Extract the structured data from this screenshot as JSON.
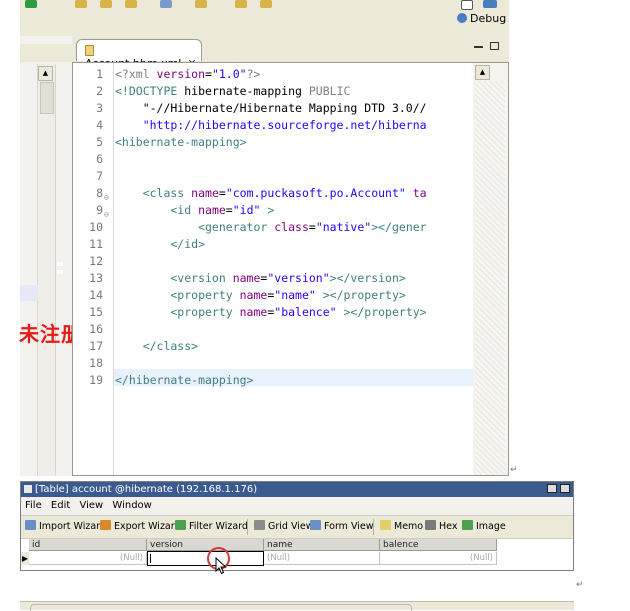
{
  "toolbar": {
    "debug_label": "Debug"
  },
  "editor": {
    "tab_label": "Account.hbm.xml",
    "lines": [
      {
        "n": "1",
        "fold": "",
        "segments": [
          {
            "c": "c-pi",
            "t": "<?xml "
          },
          {
            "c": "c-attr",
            "t": "version"
          },
          {
            "c": "c-plain",
            "t": "="
          },
          {
            "c": "c-str",
            "t": "\"1.0\""
          },
          {
            "c": "c-pi",
            "t": "?>"
          }
        ]
      },
      {
        "n": "2",
        "fold": "",
        "segments": [
          {
            "c": "c-tag",
            "t": "<!DOCTYPE "
          },
          {
            "c": "c-plain",
            "t": "hibernate-mapping "
          },
          {
            "c": "c-gray",
            "t": "PUBLIC"
          }
        ]
      },
      {
        "n": "3",
        "fold": "",
        "segments": [
          {
            "c": "c-plain",
            "t": "    \"-//Hibernate/Hibernate Mapping DTD 3.0//"
          }
        ]
      },
      {
        "n": "4",
        "fold": "",
        "segments": [
          {
            "c": "c-str",
            "t": "    \"http://hibernate.sourceforge.net/hiberna"
          }
        ]
      },
      {
        "n": "5",
        "fold": "",
        "segments": [
          {
            "c": "c-tag",
            "t": "<hibernate-mapping>"
          }
        ]
      },
      {
        "n": "6",
        "fold": "",
        "segments": []
      },
      {
        "n": "7",
        "fold": "",
        "segments": []
      },
      {
        "n": "8",
        "fold": "⊖",
        "segments": [
          {
            "c": "c-tag",
            "t": "    <class "
          },
          {
            "c": "c-attr",
            "t": "name"
          },
          {
            "c": "c-plain",
            "t": "="
          },
          {
            "c": "c-str",
            "t": "\"com.puckasoft.po.Account\""
          },
          {
            "c": "c-attr",
            "t": " ta"
          }
        ]
      },
      {
        "n": "9",
        "fold": "⊖",
        "segments": [
          {
            "c": "c-tag",
            "t": "        <id "
          },
          {
            "c": "c-attr",
            "t": "name"
          },
          {
            "c": "c-plain",
            "t": "="
          },
          {
            "c": "c-str",
            "t": "\"id\""
          },
          {
            "c": "c-tag",
            "t": " >"
          }
        ]
      },
      {
        "n": "10",
        "fold": "",
        "segments": [
          {
            "c": "c-tag",
            "t": "            <generator "
          },
          {
            "c": "c-attr",
            "t": "class"
          },
          {
            "c": "c-plain",
            "t": "="
          },
          {
            "c": "c-str",
            "t": "\"native\""
          },
          {
            "c": "c-tag",
            "t": "></gener"
          }
        ]
      },
      {
        "n": "11",
        "fold": "",
        "segments": [
          {
            "c": "c-tag",
            "t": "        </id>"
          }
        ]
      },
      {
        "n": "12",
        "fold": "",
        "segments": []
      },
      {
        "n": "13",
        "fold": "",
        "segments": [
          {
            "c": "c-tag",
            "t": "        <version "
          },
          {
            "c": "c-attr",
            "t": "name"
          },
          {
            "c": "c-plain",
            "t": "="
          },
          {
            "c": "c-str",
            "t": "\"version\""
          },
          {
            "c": "c-tag",
            "t": "></version>"
          }
        ]
      },
      {
        "n": "14",
        "fold": "",
        "segments": [
          {
            "c": "c-tag",
            "t": "        <property "
          },
          {
            "c": "c-attr",
            "t": "name"
          },
          {
            "c": "c-plain",
            "t": "="
          },
          {
            "c": "c-str",
            "t": "\"name\""
          },
          {
            "c": "c-tag",
            "t": " ></property>"
          }
        ]
      },
      {
        "n": "15",
        "fold": "",
        "segments": [
          {
            "c": "c-tag",
            "t": "        <property "
          },
          {
            "c": "c-attr",
            "t": "name"
          },
          {
            "c": "c-plain",
            "t": "="
          },
          {
            "c": "c-str",
            "t": "\"balence\""
          },
          {
            "c": "c-tag",
            "t": " ></property>"
          }
        ]
      },
      {
        "n": "16",
        "fold": "",
        "segments": []
      },
      {
        "n": "17",
        "fold": "",
        "segments": [
          {
            "c": "c-tag",
            "t": "    </class>"
          }
        ]
      },
      {
        "n": "18",
        "fold": "",
        "segments": []
      },
      {
        "n": "19",
        "fold": "",
        "segments": [
          {
            "c": "c-tag",
            "t": "</hibernate-mapping>"
          }
        ]
      }
    ]
  },
  "watermark": "未注册",
  "table_window": {
    "title": "[Table] account @hibernate (192.168.1.176)",
    "menu": [
      "File",
      "Edit",
      "View",
      "Window"
    ],
    "toolbar": {
      "import_wizard": "Import Wizard",
      "export_wizard": "Export Wizard",
      "filter_wizard": "Filter Wizard",
      "grid_view": "Grid View",
      "form_view": "Form View",
      "memo": "Memo",
      "hex": "Hex",
      "image": "Image"
    },
    "columns": [
      "id",
      "version",
      "name",
      "balence"
    ],
    "row": [
      "(Null)",
      "",
      "(Null)",
      "(Null)"
    ]
  },
  "colors": {
    "title_bar": "#3b5a8f",
    "watermark": "#e21b1b",
    "highlight_circle": "#d23a3a"
  }
}
